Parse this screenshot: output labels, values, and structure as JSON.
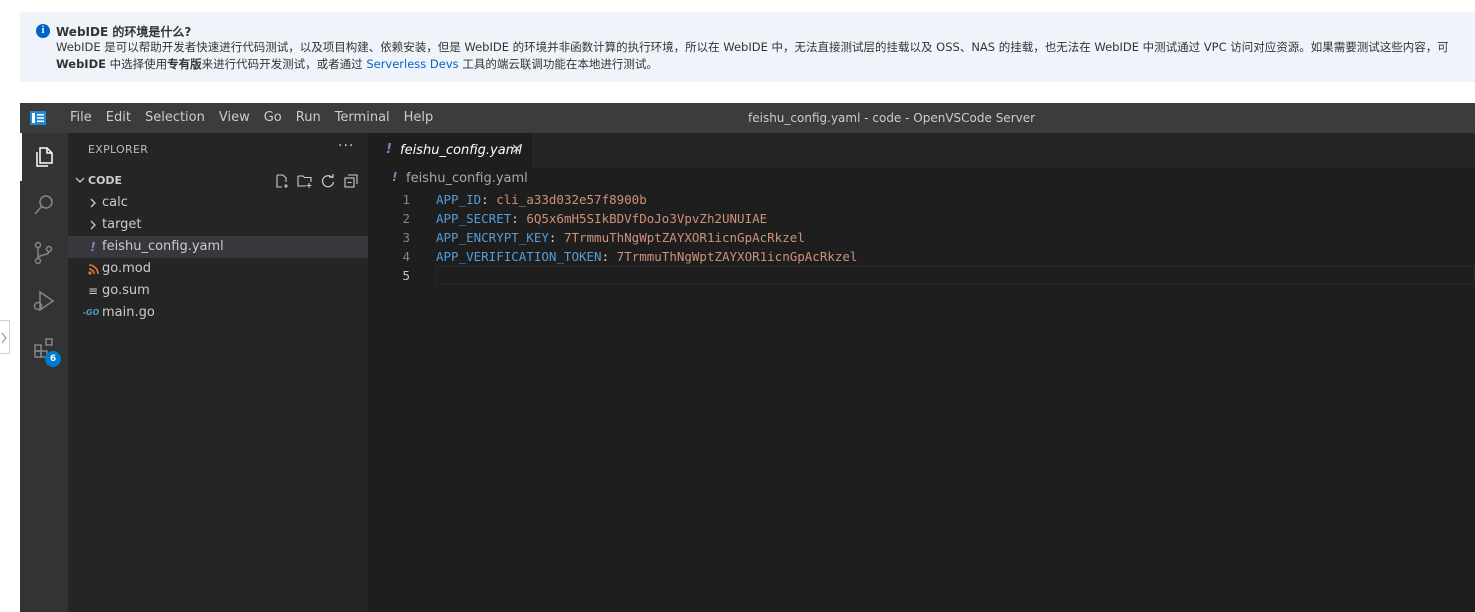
{
  "banner": {
    "title": "WebIDE 的环境是什么?",
    "line1": "WebIDE 是可以帮助开发者快速进行代码测试，以及项目构建、依赖安装，但是 WebIDE 的环境并非函数计算的执行环境，所以在 WebIDE 中，无法直接测试层的挂载以及 OSS、NAS 的挂载，也无法在 WebIDE 中测试通过 VPC 访问对应资源。如果需要测试这些内容，可",
    "line2_part1": "WebIDE",
    "line2_part2": " 中选择使用",
    "line2_part3": "专有版",
    "line2_part4": "来进行代码开发测试，或者通过 ",
    "line2_link": "Serverless Devs",
    "line2_part5": " 工具的端云联调功能在本地进行测试。"
  },
  "window": {
    "title": "feishu_config.yaml - code - OpenVSCode Server",
    "menu": [
      "File",
      "Edit",
      "Selection",
      "View",
      "Go",
      "Run",
      "Terminal",
      "Help"
    ]
  },
  "activity": {
    "items": [
      "explorer-icon",
      "search-icon",
      "source-control-icon",
      "run-debug-icon",
      "extensions-icon"
    ],
    "extensions_badge": "6"
  },
  "explorer": {
    "header": "EXPLORER",
    "more": "···",
    "section": "CODE",
    "items": [
      {
        "label": "calc",
        "icon": "chevron-right"
      },
      {
        "label": "target",
        "icon": "chevron-right"
      },
      {
        "label": "feishu_config.yaml",
        "icon": "!"
      },
      {
        "label": "go.mod",
        "icon": "rss"
      },
      {
        "label": "go.sum",
        "icon": "≡"
      },
      {
        "label": "main.go",
        "icon": "-GO"
      }
    ]
  },
  "editor": {
    "tab_label": "feishu_config.yaml",
    "tab_icon": "!",
    "tab_close": "×",
    "breadcrumb": "feishu_config.yaml",
    "lines": [
      {
        "num": "1",
        "key": "APP_ID",
        "sep": ": ",
        "value": "cli_a33d032e57f8900b"
      },
      {
        "num": "2",
        "key": "APP_SECRET",
        "sep": ": ",
        "value": "6Q5x6mH5SIkBDVfDoJo3VpvZh2UNUIAE"
      },
      {
        "num": "3",
        "key": "APP_ENCRYPT_KEY",
        "sep": ": ",
        "value": "7TrmmuThNgWptZAYXOR1icnGpAcRkzel"
      },
      {
        "num": "4",
        "key": "APP_VERIFICATION_TOKEN",
        "sep": ": ",
        "value": "7TrmmuThNgWptZAYXOR1icnGpAcRkzel"
      },
      {
        "num": "5",
        "key": "",
        "sep": "",
        "value": ""
      }
    ]
  },
  "colors": {
    "accent": "#007acc",
    "yaml_icon": "#a074c4",
    "key": "#569cd6",
    "string": "#ce9178",
    "go_icon": "#519aba",
    "mod_icon": "#e37933"
  }
}
